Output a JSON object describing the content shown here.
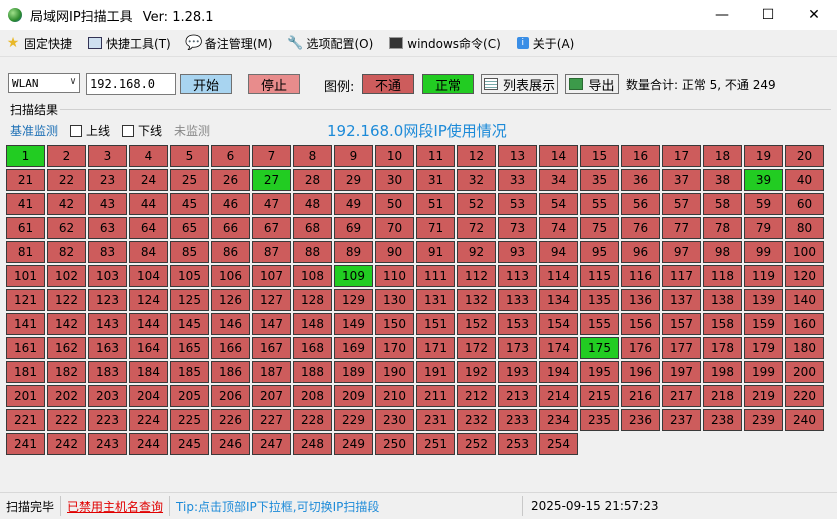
{
  "window": {
    "title": "局域网IP扫描工具",
    "version": "Ver: 1.28.1"
  },
  "menu": [
    {
      "icon": "star-icon",
      "label": "固定快捷"
    },
    {
      "icon": "tools-icon",
      "label": "快捷工具(T)"
    },
    {
      "icon": "chat-icon",
      "label": "备注管理(M)"
    },
    {
      "icon": "wrench-icon",
      "label": "选项配置(O)"
    },
    {
      "icon": "terminal-icon",
      "label": "windows命令(C)"
    },
    {
      "icon": "info-icon",
      "label": "关于(A)"
    }
  ],
  "toolbar": {
    "interface": "WLAN",
    "ip_value": "192.168.0",
    "start_label": "开始",
    "stop_label": "停止",
    "legend_label": "图例:",
    "legend_off": "不通",
    "legend_on": "正常",
    "list_label": "列表展示",
    "export_label": "导出",
    "summary": "数量合计: 正常 5, 不通 249"
  },
  "results": {
    "section_title": "扫描结果",
    "filter_base": "基准监测",
    "filter_online": "上线",
    "filter_offline": "下线",
    "filter_unmonitored": "未监测",
    "heading": "192.168.0网段IP使用情况",
    "total_cells": 254,
    "online": [
      1,
      27,
      39,
      109,
      175
    ]
  },
  "status": {
    "state": "扫描完毕",
    "hostname_ban": "已禁用主机名查询",
    "tip": "Tip:点击顶部IP下拉框,可切换IP扫描段",
    "datetime": "2025-09-15 21:57:23"
  },
  "colors": {
    "offline": "#cd5c5c",
    "online": "#22cc22",
    "heading": "#1c8ad8"
  }
}
